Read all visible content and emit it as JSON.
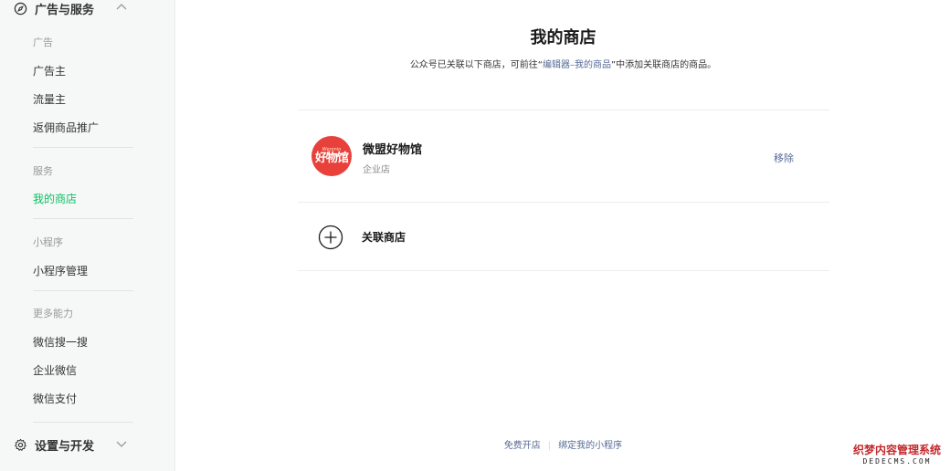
{
  "sidebar": {
    "top_group": {
      "label": "广告与服务"
    },
    "sections": [
      {
        "label": "广告",
        "items": [
          "广告主",
          "流量主",
          "返佣商品推广"
        ]
      },
      {
        "label": "服务",
        "items": [
          "我的商店"
        ]
      },
      {
        "label": "小程序",
        "items": [
          "小程序管理"
        ]
      },
      {
        "label": "更多能力",
        "items": [
          "微信搜一搜",
          "企业微信",
          "微信支付"
        ]
      }
    ],
    "active_item": "我的商店",
    "bottom_group": {
      "label": "设置与开发"
    }
  },
  "main": {
    "title": "我的商店",
    "desc_prefix": "公众号已关联以下商店，可前往“",
    "desc_link": "编辑器–我的商品",
    "desc_suffix": "”中添加关联商店的商品。",
    "shop": {
      "logo_small": "Wenmin",
      "logo_big": "好物馆",
      "name": "微盟好物馆",
      "type": "企业店",
      "remove_label": "移除"
    },
    "link_shop_label": "关联商店"
  },
  "footer": {
    "open_shop": "免费开店",
    "bind_miniprogram": "绑定我的小程序"
  },
  "watermark": {
    "line1": "织梦内容管理系统",
    "line2": "DEDECMS.COM"
  },
  "colors": {
    "accent_green": "#07c160",
    "link_blue": "#576b95",
    "logo_red": "#e8413b"
  }
}
